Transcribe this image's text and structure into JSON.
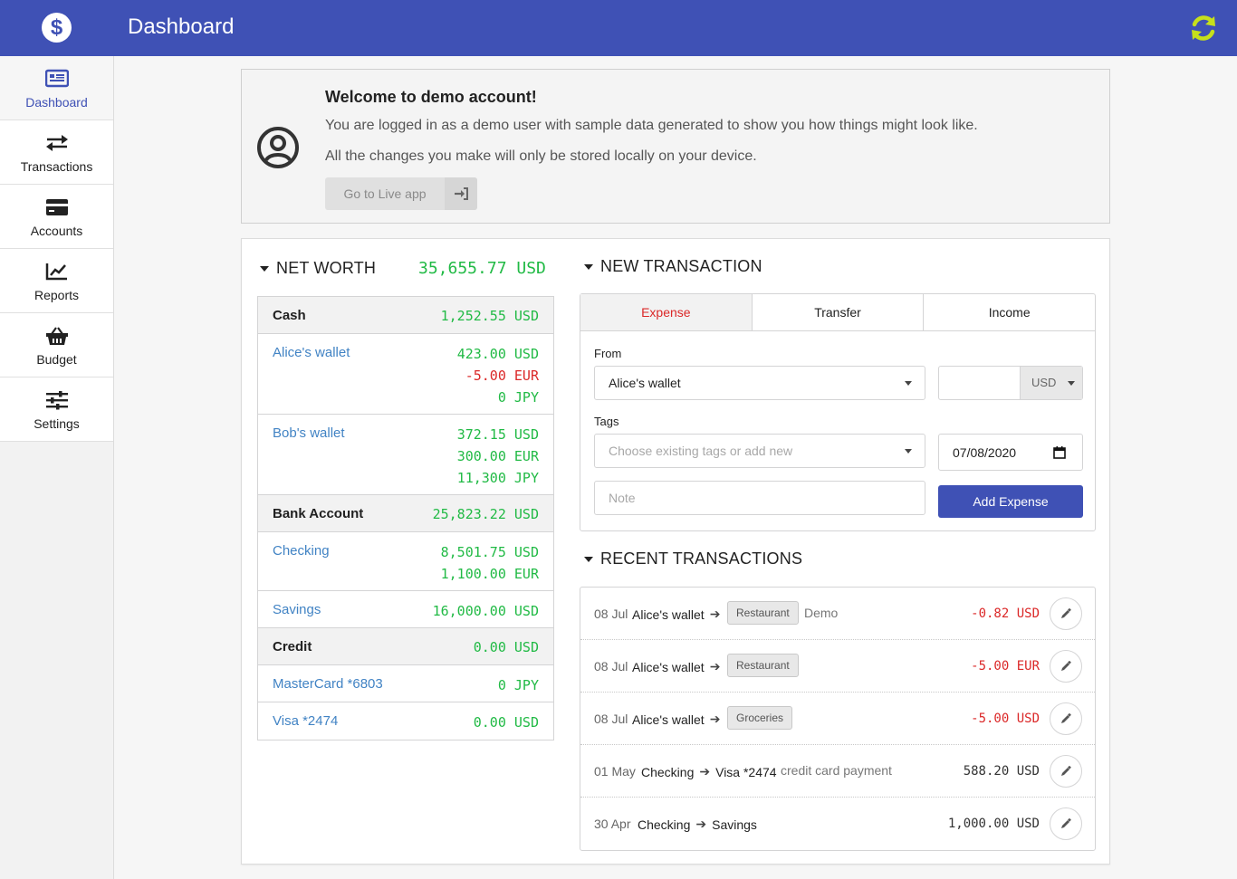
{
  "app": {
    "title": "Dashboard",
    "logo_glyph": "$",
    "brand_color": "#3f51b5",
    "sync_icon": "sync-icon"
  },
  "sidebar": {
    "items": [
      {
        "label": "Dashboard",
        "icon": "newspaper-icon",
        "active": true
      },
      {
        "label": "Transactions",
        "icon": "exchange-icon",
        "active": false
      },
      {
        "label": "Accounts",
        "icon": "credit-card-icon",
        "active": false
      },
      {
        "label": "Reports",
        "icon": "line-chart-icon",
        "active": false
      },
      {
        "label": "Budget",
        "icon": "shopping-basket-icon",
        "active": false
      },
      {
        "label": "Settings",
        "icon": "sliders-icon",
        "active": false
      }
    ]
  },
  "welcome": {
    "title": "Welcome to demo account!",
    "line1": "You are logged in as a demo user with sample data generated to show you how things might look like.",
    "line2": "All the changes you make will only be stored locally on your device.",
    "button_label": "Go to Live app"
  },
  "net_worth": {
    "heading": "NET WORTH",
    "total": "35,655.77 USD",
    "groups": [
      {
        "name": "Cash",
        "total": "1,252.55 USD",
        "accounts": [
          {
            "name": "Alice's wallet",
            "balances": [
              {
                "text": "423.00 USD",
                "tone": "green"
              },
              {
                "text": "-5.00 EUR",
                "tone": "red"
              },
              {
                "text": "0 JPY",
                "tone": "green"
              }
            ]
          },
          {
            "name": "Bob's wallet",
            "balances": [
              {
                "text": "372.15 USD",
                "tone": "green"
              },
              {
                "text": "300.00 EUR",
                "tone": "green"
              },
              {
                "text": "11,300 JPY",
                "tone": "green"
              }
            ]
          }
        ]
      },
      {
        "name": "Bank Account",
        "total": "25,823.22 USD",
        "accounts": [
          {
            "name": "Checking",
            "balances": [
              {
                "text": "8,501.75 USD",
                "tone": "green"
              },
              {
                "text": "1,100.00 EUR",
                "tone": "green"
              }
            ]
          },
          {
            "name": "Savings",
            "balances": [
              {
                "text": "16,000.00 USD",
                "tone": "green"
              }
            ]
          }
        ]
      },
      {
        "name": "Credit",
        "total": "0.00 USD",
        "accounts": [
          {
            "name": "MasterCard *6803",
            "balances": [
              {
                "text": "0 JPY",
                "tone": "green"
              }
            ]
          },
          {
            "name": "Visa *2474",
            "balances": [
              {
                "text": "0.00 USD",
                "tone": "green"
              }
            ]
          }
        ]
      }
    ]
  },
  "new_transaction": {
    "heading": "NEW TRANSACTION",
    "tabs": [
      "Expense",
      "Transfer",
      "Income"
    ],
    "from_label": "From",
    "from_value": "Alice's wallet",
    "currency": "USD",
    "amount_value": "",
    "tags_label": "Tags",
    "tags_placeholder": "Choose existing tags or add new",
    "date_value": "07/08/2020",
    "note_placeholder": "Note",
    "submit_label": "Add Expense"
  },
  "recent": {
    "heading": "RECENT TRANSACTIONS",
    "rows": [
      {
        "date": "08 Jul",
        "from": "Alice's wallet",
        "to": "",
        "tag": "Restaurant",
        "note": "Demo",
        "amount": "-0.82 USD",
        "tone": "red"
      },
      {
        "date": "08 Jul",
        "from": "Alice's wallet",
        "to": "",
        "tag": "Restaurant",
        "note": "",
        "amount": "-5.00 EUR",
        "tone": "red"
      },
      {
        "date": "08 Jul",
        "from": "Alice's wallet",
        "to": "",
        "tag": "Groceries",
        "note": "",
        "amount": "-5.00 USD",
        "tone": "red"
      },
      {
        "date": "01 May",
        "from": "Checking",
        "to": "Visa *2474",
        "tag": "",
        "note": "credit card payment",
        "amount": "588.20 USD",
        "tone": "neutral"
      },
      {
        "date": "30 Apr",
        "from": "Checking",
        "to": "Savings",
        "tag": "",
        "note": "",
        "amount": "1,000.00 USD",
        "tone": "neutral"
      }
    ]
  }
}
